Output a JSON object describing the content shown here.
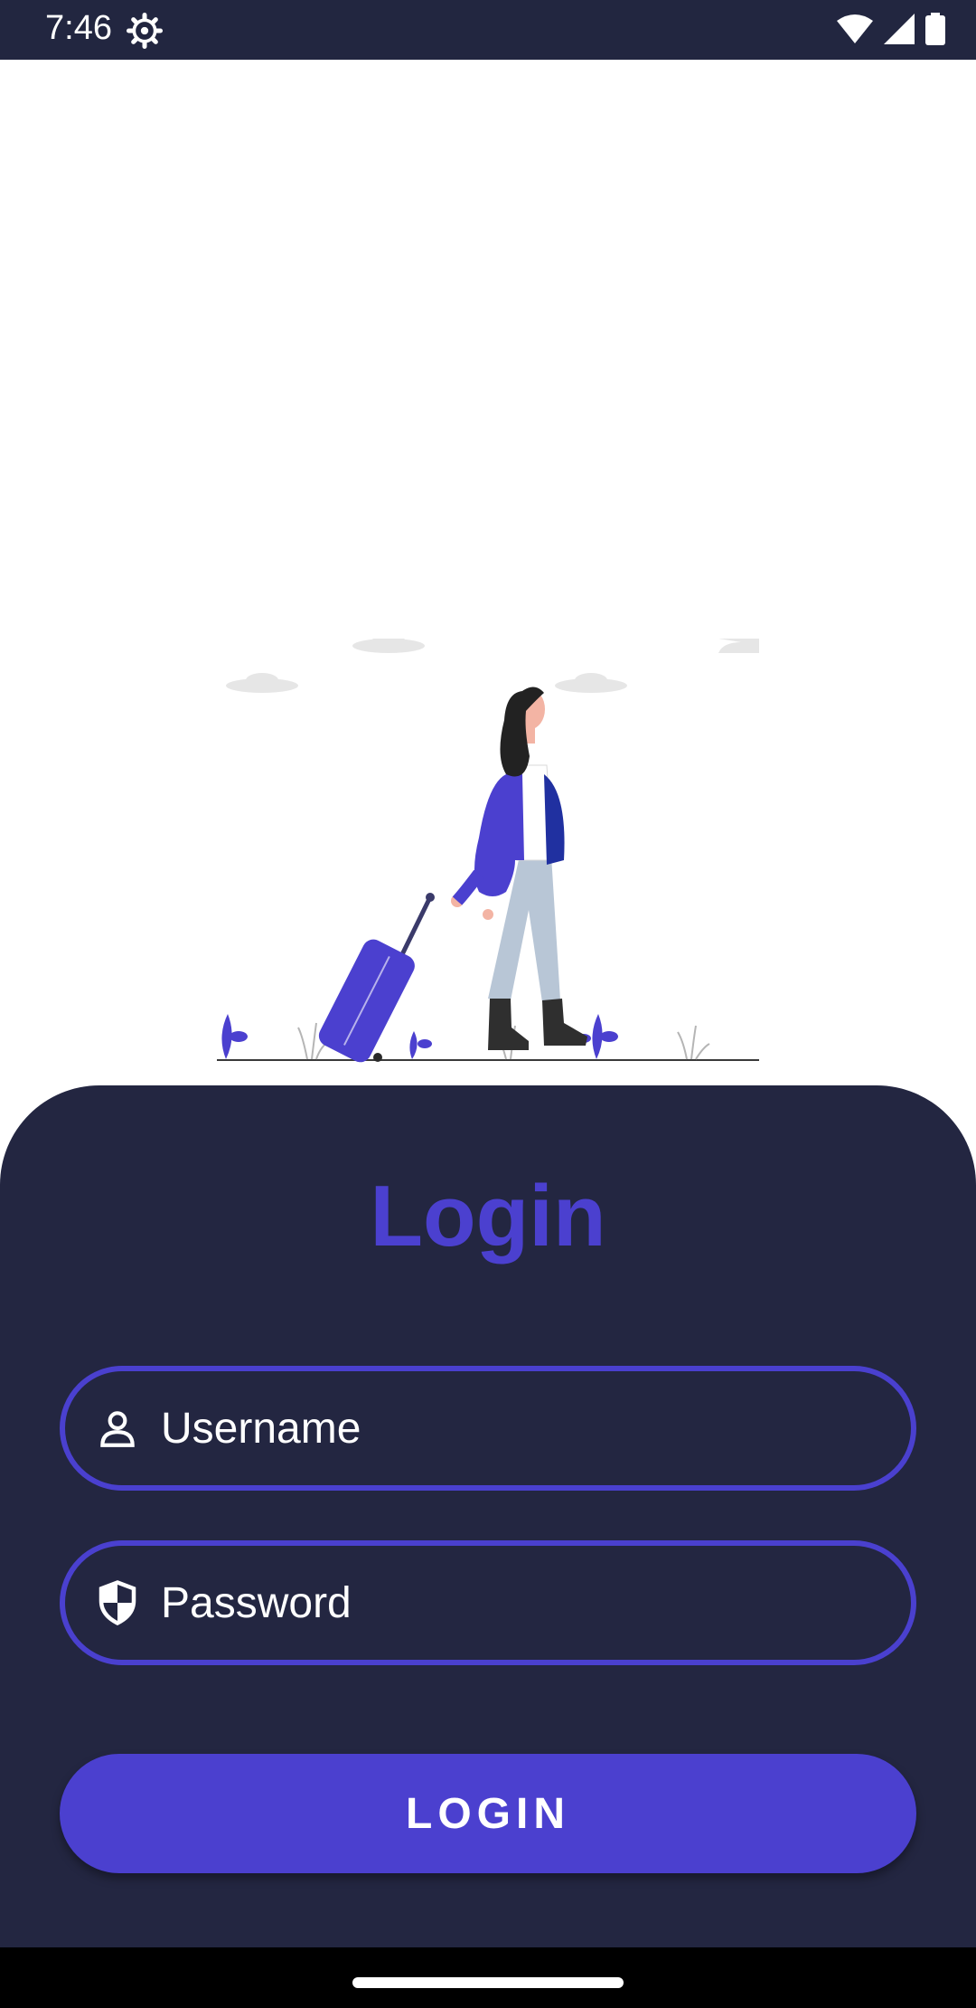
{
  "status_bar": {
    "time": "7:46",
    "icons": [
      "settings-icon",
      "wifi-icon",
      "signal-icon",
      "battery-icon"
    ]
  },
  "illustration": {
    "description_icon": "traveler-with-suitcase-illustration"
  },
  "login": {
    "title": "Login",
    "username_placeholder": "Username",
    "password_placeholder": "Password",
    "button_label": "LOGIN"
  },
  "colors": {
    "accent": "#4b40cf",
    "panel": "#232641",
    "status_bar": "#222640"
  }
}
